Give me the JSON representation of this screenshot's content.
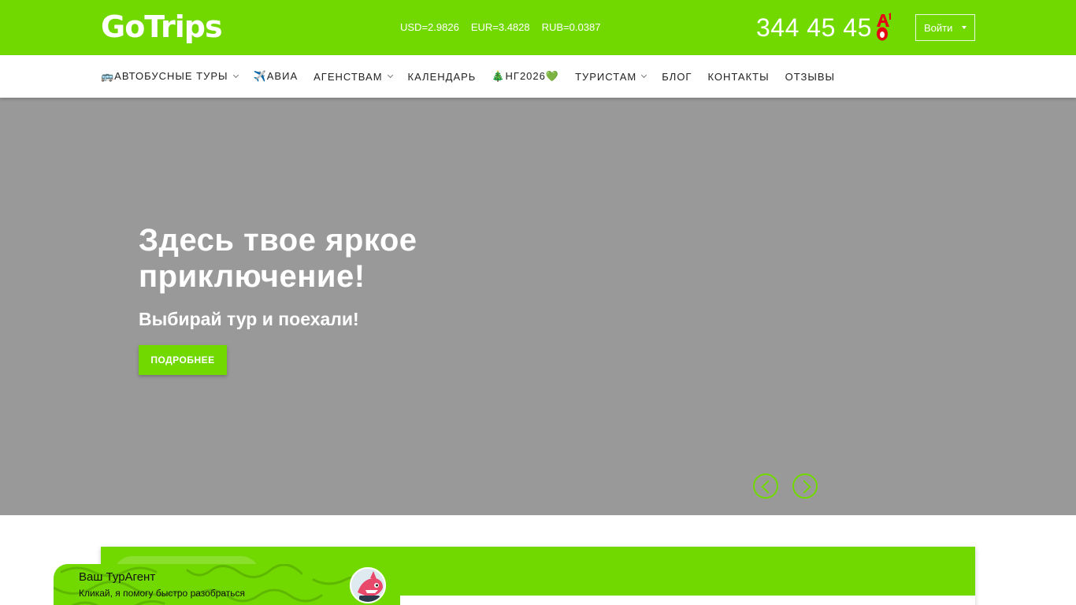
{
  "header": {
    "logo": "GoTrips",
    "rates": [
      "USD=2.9826",
      "EUR=3.4828",
      "RUB=0.0387"
    ],
    "phone": "344 45 45",
    "operator_icon": "a1-operator-icon",
    "login_label": "Войти"
  },
  "nav": {
    "items": [
      {
        "label": "🚌АВТОБУСНЫЕ ТУРЫ",
        "dropdown": true
      },
      {
        "label": "✈️АВИА",
        "dropdown": false
      },
      {
        "label": "АГЕНСТВАМ",
        "dropdown": true
      },
      {
        "label": "КАЛЕНДАРЬ",
        "dropdown": false
      },
      {
        "label": "🎄НГ2026💚",
        "dropdown": false
      },
      {
        "label": "ТУРИСТАМ",
        "dropdown": true
      },
      {
        "label": "БЛОГ",
        "dropdown": false
      },
      {
        "label": "КОНТАКТЫ",
        "dropdown": false
      },
      {
        "label": "ОТЗЫВЫ",
        "dropdown": false
      }
    ]
  },
  "hero": {
    "title": "Здесь твое яркое приключение!",
    "subtitle": "Выбирай тур и поехали!",
    "button": "ПОДРОБНЕЕ"
  },
  "chat": {
    "title": "Ваш ТурАгент",
    "subtitle": "Кликай, я помогу быстро разобраться"
  },
  "colors": {
    "brand_green": "#72d900",
    "hero_bg": "#999999"
  }
}
